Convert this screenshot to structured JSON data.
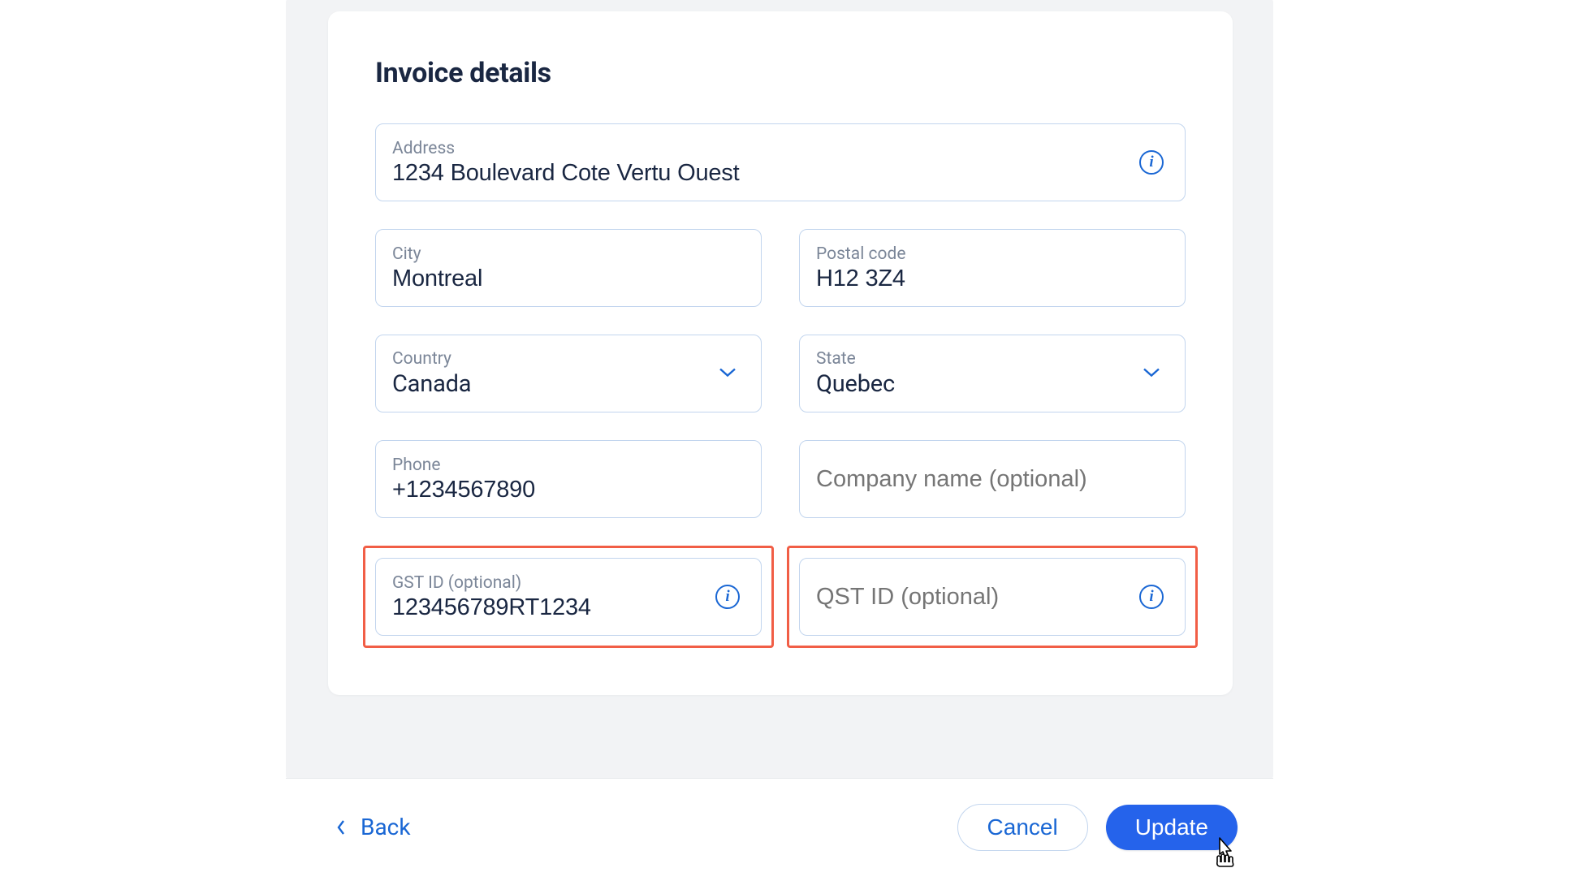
{
  "card": {
    "title": "Invoice details",
    "address": {
      "label": "Address",
      "value": "1234 Boulevard Cote Vertu Ouest"
    },
    "city": {
      "label": "City",
      "value": "Montreal"
    },
    "postal": {
      "label": "Postal code",
      "value": "H12 3Z4"
    },
    "country": {
      "label": "Country",
      "value": "Canada"
    },
    "state": {
      "label": "State",
      "value": "Quebec"
    },
    "phone": {
      "label": "Phone",
      "value": "+1234567890"
    },
    "company": {
      "placeholder": "Company name (optional)",
      "value": ""
    },
    "gst": {
      "label": "GST ID (optional)",
      "value": "123456789RT1234"
    },
    "qst": {
      "placeholder": "QST ID (optional)",
      "value": ""
    }
  },
  "footer": {
    "back": "Back",
    "cancel": "Cancel",
    "update": "Update"
  },
  "colors": {
    "accent": "#1a67d4",
    "primary_button": "#2563eb",
    "highlight_border": "#f15e46",
    "field_border": "#c2d5ee",
    "text_dark": "#1a2742",
    "text_muted": "#7b8698"
  }
}
